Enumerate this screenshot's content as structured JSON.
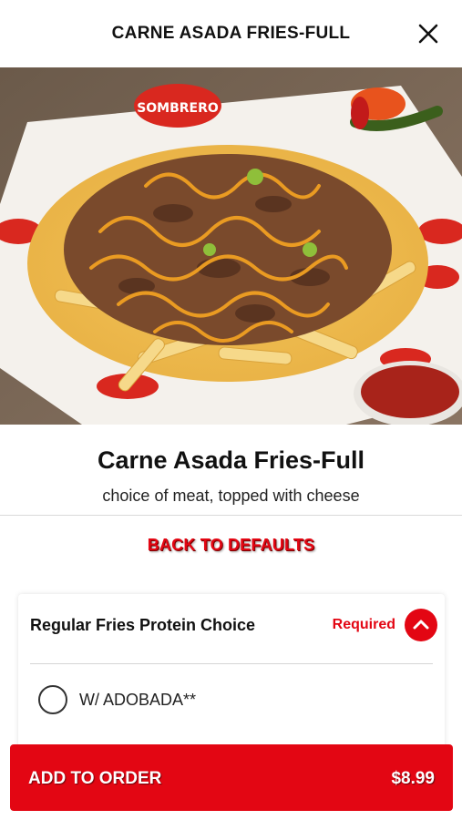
{
  "header": {
    "title": "CARNE ASADA FRIES-FULL",
    "close_icon": "close-icon"
  },
  "hero": {
    "image": "carne-asada-fries-photo",
    "brand_logo_text": "SOMBRERO"
  },
  "item": {
    "name": "Carne Asada Fries-Full",
    "description": "choice of meat, topped with cheese"
  },
  "actions": {
    "back_to_defaults": "BACK TO DEFAULTS"
  },
  "section": {
    "title": "Regular Fries Protein Choice",
    "required_label": "Required",
    "toggle_icon": "chevron-up-icon",
    "options": [
      {
        "label": "W/ ADOBADA**",
        "selected": false
      }
    ]
  },
  "cart": {
    "add_label": "ADD TO ORDER",
    "price": "$8.99"
  },
  "colors": {
    "accent": "#e30613",
    "background": "#ffffff",
    "text": "#111111"
  }
}
